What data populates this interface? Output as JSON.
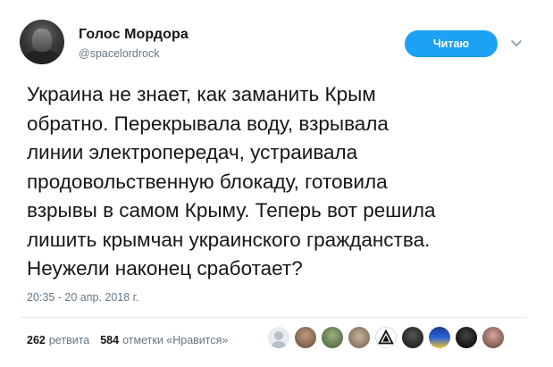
{
  "profile": {
    "display_name": "Голос Мордора",
    "handle": "@spacelordrock"
  },
  "follow_button": {
    "label": "Читаю"
  },
  "tweet": {
    "lines": [
      "Украина не знает, как заманить Крым",
      "обратно. Перекрывала воду, взрывала",
      "линии электропередач, устраивала",
      "продовольственную блокаду, готовила",
      "взрывы в самом Крыму. Теперь вот решила",
      "лишить крымчан украинского гражданства.",
      "Неужели наконец сработает?"
    ],
    "timestamp": "20:35 - 20 апр. 2018 г."
  },
  "stats": {
    "retweets_count": "262",
    "retweets_label": "ретвита",
    "likes_count": "584",
    "likes_label": "отметки «Нравится»"
  },
  "colors": {
    "accent": "#1da1f2",
    "text": "#14171a",
    "secondary": "#657786",
    "divider": "#e6ecf0"
  },
  "liker_avatars": [
    {
      "icon": "user-avatar-1"
    },
    {
      "icon": "user-avatar-2"
    },
    {
      "icon": "user-avatar-3"
    },
    {
      "icon": "user-avatar-4"
    },
    {
      "icon": "user-avatar-5"
    },
    {
      "icon": "user-avatar-6"
    },
    {
      "icon": "user-avatar-7"
    },
    {
      "icon": "user-avatar-8"
    },
    {
      "icon": "user-avatar-9"
    },
    {
      "icon": "user-avatar-10"
    }
  ]
}
